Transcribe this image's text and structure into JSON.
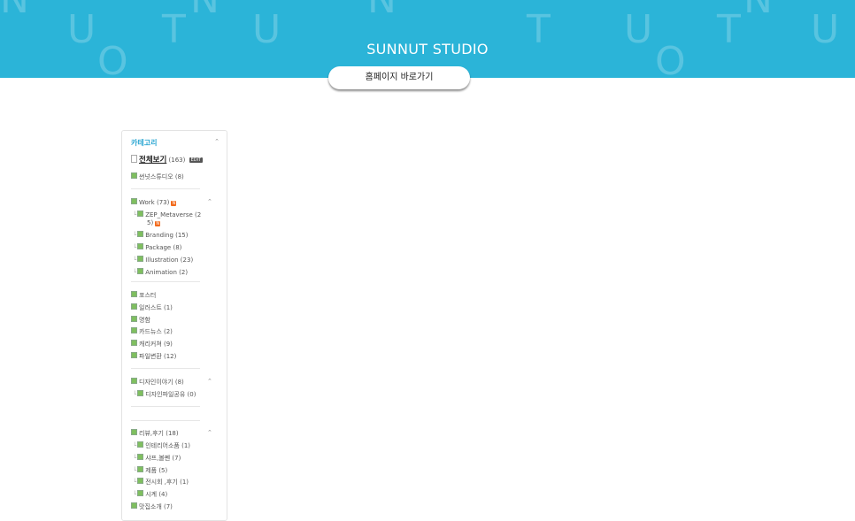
{
  "brand": {
    "title": "SUNNUT STUDIO",
    "home_button": "홈페이지 바로가기",
    "bg_color": "#2bb4d8"
  },
  "banner_letters": [
    "U",
    "T",
    "U",
    "O",
    "T",
    "U",
    "O",
    "T",
    "U",
    "N",
    "N",
    "N",
    "N"
  ],
  "category": {
    "title": "카테고리",
    "all": {
      "label": "전체보기",
      "count": "(163)",
      "badge": "EDIT"
    },
    "groups": [
      {
        "label": "썬넛스튜디오",
        "count": "(8)"
      },
      {
        "label": "Work",
        "count": "(73)",
        "children": [
          {
            "label": "ZEP_Metaverse (2",
            "label2": "5)"
          },
          {
            "label": "Branding (15)"
          },
          {
            "label": "Package (8)"
          },
          {
            "label": "Illustration (23)"
          },
          {
            "label": "Animation (2)"
          }
        ]
      },
      {
        "items": [
          {
            "label": "포스터"
          },
          {
            "label": "일러스트 (1)"
          },
          {
            "label": "명함"
          },
          {
            "label": "카드뉴스 (2)"
          },
          {
            "label": "캐리커쳐 (9)"
          },
          {
            "label": "파일변환 (12)"
          }
        ]
      },
      {
        "label": "디자인이야기 (8)",
        "children": [
          {
            "label": "디자인파일공유 (0)"
          }
        ]
      },
      {
        "label": "리뷰,후기 (18)",
        "children": [
          {
            "label": "인테리어소품 (1)"
          },
          {
            "label": "샤프,볼펜 (7)"
          },
          {
            "label": "제품 (5)"
          },
          {
            "label": "전시회 ,후기 (1)"
          },
          {
            "label": "시계 (4)"
          }
        ]
      },
      {
        "label": "맛집소개 (7)"
      }
    ]
  }
}
